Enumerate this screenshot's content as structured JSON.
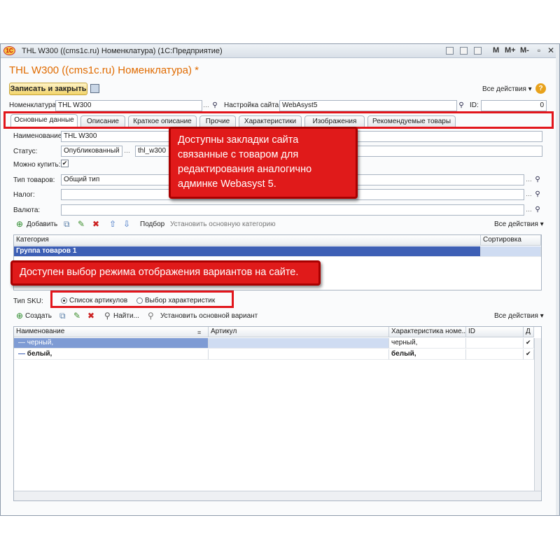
{
  "window": {
    "title": "THL W300 ((cms1c.ru) Номенклатура)  (1С:Предприятие)",
    "logo": "1С",
    "controls": [
      "M",
      "M+",
      "M-"
    ]
  },
  "document": {
    "title": "THL W300 ((cms1c.ru) Номенклатура) *"
  },
  "toolbar": {
    "save_close": "Записать и закрыть",
    "all_actions": "Все действия ▾",
    "help": "?"
  },
  "header": {
    "nomenclature_label": "Номенклатура:",
    "nomenclature_value": "THL W300",
    "site_label": "Настройка сайта:",
    "site_value": "WebAsyst5",
    "id_label": "ID:",
    "id_value": "0"
  },
  "tabs": [
    "Основные данные",
    "Описание",
    "Краткое описание",
    "Прочие",
    "Характеристики",
    "Изображения",
    "Рекомендуемые товары"
  ],
  "form": {
    "name_label": "Наименование:",
    "name_value": "THL W300",
    "status_label": "Статус:",
    "status_value": "Опубликованный",
    "slug_value": "thl_w300",
    "can_buy_label": "Можно купить:",
    "can_buy_check": "✔",
    "type_label": "Тип товаров:",
    "type_value": "Общий тип",
    "tax_label": "Налог:",
    "tax_value": "",
    "currency_label": "Валюта:",
    "currency_value": ""
  },
  "category_toolbar": {
    "add": "Добавить",
    "select": "Подбор",
    "set_main": "Установить основную категорию",
    "all_actions": "Все действия ▾"
  },
  "category_table": {
    "columns": [
      "Категория",
      "Сортировка"
    ],
    "rows": [
      {
        "category": "Группа товаров 1",
        "sort": ""
      }
    ]
  },
  "sku": {
    "label": "Тип SKU:",
    "option1": "Список артикулов",
    "option2": "Выбор характеристик"
  },
  "variant_toolbar": {
    "create": "Создать",
    "find": "Найти...",
    "set_main": "Установить основной вариант",
    "all_actions": "Все действия ▾"
  },
  "variant_table": {
    "columns": [
      "Наименование",
      "Артикул",
      "Характеристика номе...",
      "ID",
      "Д"
    ],
    "rows": [
      {
        "name": "черный,",
        "article": "",
        "char": "черный,",
        "id": "",
        "check": "✔"
      },
      {
        "name": "белый,",
        "article": "",
        "char": "белый,",
        "id": "",
        "check": "✔"
      }
    ]
  },
  "callouts": {
    "tabs_note": "Доступны закладки сайта связанные с товаром для редактирования аналогично админке Webasyst 5.",
    "sku_note": "Доступен выбор режима отображения вариантов на сайте."
  },
  "colors": {
    "accent": "#e06b00",
    "callout": "#e01a1a",
    "selected_row": "#3d5fb5"
  }
}
